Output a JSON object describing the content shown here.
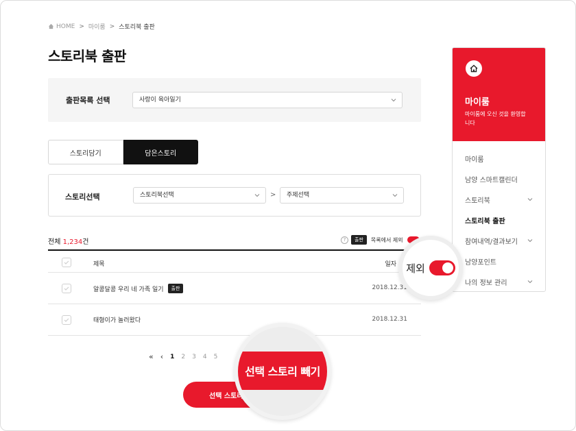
{
  "breadcrumb": {
    "home": "HOME",
    "level1": "마이룸",
    "current": "스토리북 출판",
    "separator": ">"
  },
  "page_title": "스토리북 출판",
  "publish_select": {
    "label": "출판목록 선택",
    "value": "사랑이 육아일기"
  },
  "tabs": [
    {
      "label": "스토리담기"
    },
    {
      "label": "담은스토리",
      "active": true
    }
  ],
  "story_select": {
    "label": "스토리선택",
    "storybook": "스토리북선택",
    "arrow": ">",
    "topic": "주제선택"
  },
  "total": {
    "prefix": "전체 ",
    "count": "1,234",
    "suffix": "건"
  },
  "exclude_option": {
    "help": "?",
    "badge": "출판",
    "label": "목록에서 제외",
    "on": true
  },
  "table": {
    "headers": {
      "title": "제목",
      "date": "일자"
    },
    "rows": [
      {
        "title": "알콩달콩 우리 네 가족 일기",
        "badge": "출판",
        "date": "2018.12.31"
      },
      {
        "title": "태형이가 놀러왔다",
        "badge": "",
        "date": "2018.12.31"
      }
    ]
  },
  "pagination": {
    "first": "«",
    "prev": "‹",
    "pages": [
      "1",
      "2",
      "3",
      "4",
      "5"
    ],
    "current": "1"
  },
  "bottom_button": {
    "label": "선택 스토리"
  },
  "sidebar": {
    "title": "마이룸",
    "desc": "마이룸에 오신 것을 환영합니다",
    "items": [
      {
        "label": "마이룸",
        "chevron": false
      },
      {
        "label": "남양 스마트캘린더",
        "chevron": false
      },
      {
        "label": "스토리북",
        "chevron": true
      },
      {
        "label": "스토리북 출판",
        "chevron": false,
        "active": true
      },
      {
        "label": "참여내역/결과보기",
        "chevron": true
      },
      {
        "label": "남양포인트",
        "chevron": false
      },
      {
        "label": "나의 정보 관리",
        "chevron": true
      }
    ]
  },
  "zoom_toggle": {
    "label": "제외"
  },
  "zoom_button": {
    "label": "선택 스토리 빼기"
  },
  "colors": {
    "accent": "#e8192c",
    "dark": "#111111"
  }
}
